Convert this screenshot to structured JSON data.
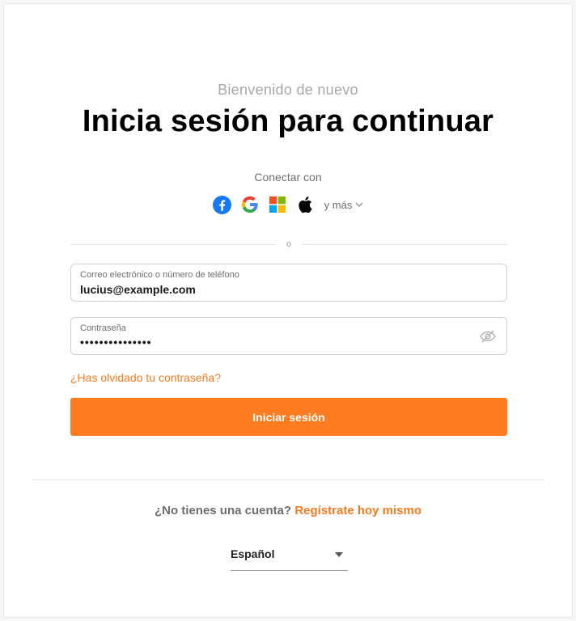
{
  "header": {
    "subtitle": "Bienvenido de nuevo",
    "title": "Inicia sesión para continuar"
  },
  "social": {
    "label": "Conectar con",
    "providers": [
      {
        "name": "Facebook",
        "icon": "facebook-icon"
      },
      {
        "name": "Google",
        "icon": "google-icon"
      },
      {
        "name": "Microsoft",
        "icon": "microsoft-icon"
      },
      {
        "name": "Apple",
        "icon": "apple-icon"
      }
    ],
    "more_label": "y más"
  },
  "divider": {
    "text": "o"
  },
  "form": {
    "email": {
      "label": "Correo electrónico o número de teléfono",
      "value": "lucius@example.com"
    },
    "password": {
      "label": "Contraseña",
      "value": "•••••••••••••••",
      "toggle_icon": "eye-off-icon"
    },
    "forgot_link": "¿Has olvidado tu contraseña?",
    "submit_label": "Iniciar sesión"
  },
  "signup": {
    "prompt": "¿No tienes una cuenta?",
    "link": "Regístrate hoy mismo"
  },
  "language": {
    "selected": "Español"
  },
  "colors": {
    "accent": "#ff7c21",
    "link": "#f47b20"
  }
}
